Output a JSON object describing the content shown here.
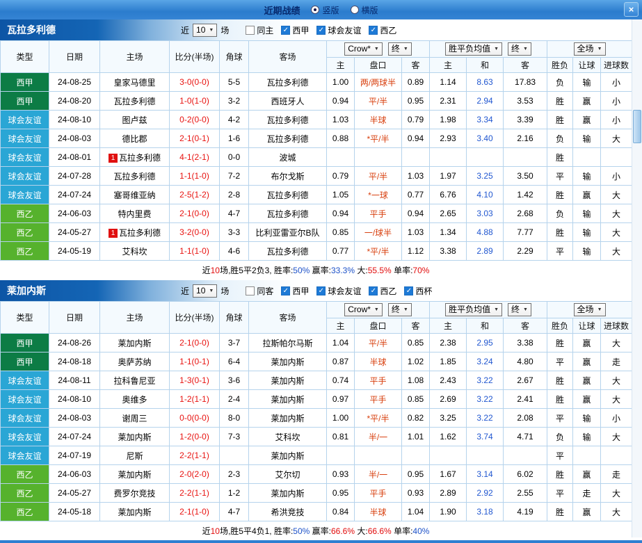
{
  "titlebar": {
    "title": "近期战绩",
    "radios": [
      {
        "label": "竖版",
        "selected": true
      },
      {
        "label": "横版",
        "selected": false
      }
    ],
    "close_label": "×"
  },
  "table_header": {
    "left": [
      "类型",
      "日期",
      "主场",
      "比分(半场)",
      "角球",
      "客场"
    ],
    "sub": [
      "主",
      "盘口",
      "客",
      "主",
      "和",
      "客",
      "胜负",
      "让球",
      "进球数"
    ]
  },
  "type_colors": {
    "西甲": "#0c7c45",
    "球会友谊": "#2aa6d5",
    "西乙": "#56b22d"
  },
  "colors": {
    "result_red": "#e10b0b",
    "result_blue": "#1c51c8",
    "result_green": "#0fa00f",
    "score_red": "#e8120f",
    "handicap_red": "#d8400f",
    "avg_mid_blue": "#2157d0",
    "tracked_team_green": "#13a113"
  },
  "sections": [
    {
      "team": "瓦拉多利德",
      "near_label": "近",
      "games": "10",
      "games_suffix": "场",
      "filters": [
        {
          "label": "同主",
          "checked": false
        },
        {
          "label": "西甲",
          "checked": true
        },
        {
          "label": "球会友谊",
          "checked": true
        },
        {
          "label": "西乙",
          "checked": true
        }
      ],
      "selects": {
        "bookmaker": "Crow*",
        "book_time": "终",
        "avg": "胜平负均值",
        "avg_time": "终",
        "scope": "全场"
      },
      "rows": [
        {
          "type": "西甲",
          "date": "24-08-25",
          "home": "皇家马德里",
          "home_t": false,
          "badge": false,
          "score": "3-0(0-0)",
          "corner": "5-5",
          "away": "瓦拉多利德",
          "away_t": true,
          "o_home": "1.00",
          "handicap": "两/两球半",
          "o_away": "0.89",
          "avg_home": "1.14",
          "avg_draw": "8.63",
          "avg_away": "17.83",
          "res": "负",
          "ah": "输",
          "ou": "小"
        },
        {
          "type": "西甲",
          "date": "24-08-20",
          "home": "瓦拉多利德",
          "home_t": true,
          "badge": false,
          "score": "1-0(1-0)",
          "corner": "3-2",
          "away": "西班牙人",
          "away_t": false,
          "o_home": "0.94",
          "handicap": "平/半",
          "o_away": "0.95",
          "avg_home": "2.31",
          "avg_draw": "2.94",
          "avg_away": "3.53",
          "res": "胜",
          "ah": "赢",
          "ou": "小"
        },
        {
          "type": "球会友谊",
          "date": "24-08-10",
          "home": "图卢兹",
          "home_t": false,
          "badge": false,
          "score": "0-2(0-0)",
          "corner": "4-2",
          "away": "瓦拉多利德",
          "away_t": true,
          "o_home": "1.03",
          "handicap": "半球",
          "o_away": "0.79",
          "avg_home": "1.98",
          "avg_draw": "3.34",
          "avg_away": "3.39",
          "res": "胜",
          "ah": "赢",
          "ou": "小"
        },
        {
          "type": "球会友谊",
          "date": "24-08-03",
          "home": "德比郡",
          "home_t": false,
          "badge": false,
          "score": "2-1(0-1)",
          "corner": "1-6",
          "away": "瓦拉多利德",
          "away_t": true,
          "o_home": "0.88",
          "handicap": "*平/半",
          "o_away": "0.94",
          "avg_home": "2.93",
          "avg_draw": "3.40",
          "avg_away": "2.16",
          "res": "负",
          "ah": "输",
          "ou": "大"
        },
        {
          "type": "球会友谊",
          "date": "24-08-01",
          "home": "瓦拉多利德",
          "home_t": true,
          "badge": true,
          "score": "4-1(2-1)",
          "corner": "0-0",
          "away": "波城",
          "away_t": false,
          "o_home": "",
          "handicap": "",
          "o_away": "",
          "avg_home": "",
          "avg_draw": "",
          "avg_away": "",
          "res": "胜",
          "ah": "",
          "ou": ""
        },
        {
          "type": "球会友谊",
          "date": "24-07-28",
          "home": "瓦拉多利德",
          "home_t": true,
          "badge": false,
          "score": "1-1(1-0)",
          "corner": "7-2",
          "away": "布尔戈斯",
          "away_t": false,
          "o_home": "0.79",
          "handicap": "平/半",
          "o_away": "1.03",
          "avg_home": "1.97",
          "avg_draw": "3.25",
          "avg_away": "3.50",
          "res": "平",
          "ah": "输",
          "ou": "小"
        },
        {
          "type": "球会友谊",
          "date": "24-07-24",
          "home": "塞哥维亚纳",
          "home_t": false,
          "badge": false,
          "score": "2-5(1-2)",
          "corner": "2-8",
          "away": "瓦拉多利德",
          "away_t": true,
          "o_home": "1.05",
          "handicap": "*一球",
          "o_away": "0.77",
          "avg_home": "6.76",
          "avg_draw": "4.10",
          "avg_away": "1.42",
          "res": "胜",
          "ah": "赢",
          "ou": "大"
        },
        {
          "type": "西乙",
          "date": "24-06-03",
          "home": "特内里费",
          "home_t": false,
          "badge": false,
          "score": "2-1(0-0)",
          "corner": "4-7",
          "away": "瓦拉多利德",
          "away_t": true,
          "o_home": "0.94",
          "handicap": "平手",
          "o_away": "0.94",
          "avg_home": "2.65",
          "avg_draw": "3.03",
          "avg_away": "2.68",
          "res": "负",
          "ah": "输",
          "ou": "大"
        },
        {
          "type": "西乙",
          "date": "24-05-27",
          "home": "瓦拉多利德",
          "home_t": true,
          "badge": true,
          "score": "3-2(0-0)",
          "corner": "3-3",
          "away": "比利亚雷亚尔B队",
          "away_t": false,
          "o_home": "0.85",
          "handicap": "一/球半",
          "o_away": "1.03",
          "avg_home": "1.34",
          "avg_draw": "4.88",
          "avg_away": "7.77",
          "res": "胜",
          "ah": "输",
          "ou": "大"
        },
        {
          "type": "西乙",
          "date": "24-05-19",
          "home": "艾科坎",
          "home_t": false,
          "badge": false,
          "score": "1-1(1-0)",
          "corner": "4-6",
          "away": "瓦拉多利德",
          "away_t": true,
          "o_home": "0.77",
          "handicap": "*平/半",
          "o_away": "1.12",
          "avg_home": "3.38",
          "avg_draw": "2.89",
          "avg_away": "2.29",
          "res": "平",
          "ah": "输",
          "ou": "大"
        }
      ],
      "summary": [
        {
          "t": "近",
          "c": "k"
        },
        {
          "t": "10",
          "c": "r"
        },
        {
          "t": "场,胜5平2负3, 胜率:",
          "c": "k"
        },
        {
          "t": "50%",
          "c": "b"
        },
        {
          "t": " 赢率:",
          "c": "k"
        },
        {
          "t": "33.3%",
          "c": "b"
        },
        {
          "t": " 大:",
          "c": "k"
        },
        {
          "t": "55.5%",
          "c": "r"
        },
        {
          "t": " 单率:",
          "c": "k"
        },
        {
          "t": "70%",
          "c": "r"
        }
      ]
    },
    {
      "team": "莱加内斯",
      "near_label": "近",
      "games": "10",
      "games_suffix": "场",
      "filters": [
        {
          "label": "同客",
          "checked": false
        },
        {
          "label": "西甲",
          "checked": true
        },
        {
          "label": "球会友谊",
          "checked": true
        },
        {
          "label": "西乙",
          "checked": true
        },
        {
          "label": "西杯",
          "checked": true
        }
      ],
      "selects": {
        "bookmaker": "Crow*",
        "book_time": "终",
        "avg": "胜平负均值",
        "avg_time": "终",
        "scope": "全场"
      },
      "rows": [
        {
          "type": "西甲",
          "date": "24-08-26",
          "home": "莱加内斯",
          "home_t": true,
          "badge": false,
          "score": "2-1(0-0)",
          "corner": "3-7",
          "away": "拉斯帕尔马斯",
          "away_t": false,
          "o_home": "1.04",
          "handicap": "平/半",
          "o_away": "0.85",
          "avg_home": "2.38",
          "avg_draw": "2.95",
          "avg_away": "3.38",
          "res": "胜",
          "ah": "赢",
          "ou": "大"
        },
        {
          "type": "西甲",
          "date": "24-08-18",
          "home": "奥萨苏纳",
          "home_t": false,
          "badge": false,
          "score": "1-1(0-1)",
          "corner": "6-4",
          "away": "莱加内斯",
          "away_t": true,
          "o_home": "0.87",
          "handicap": "半球",
          "o_away": "1.02",
          "avg_home": "1.85",
          "avg_draw": "3.24",
          "avg_away": "4.80",
          "res": "平",
          "ah": "赢",
          "ou": "走"
        },
        {
          "type": "球会友谊",
          "date": "24-08-11",
          "home": "拉科鲁尼亚",
          "home_t": false,
          "badge": false,
          "score": "1-3(0-1)",
          "corner": "3-6",
          "away": "莱加内斯",
          "away_t": true,
          "o_home": "0.74",
          "handicap": "平手",
          "o_away": "1.08",
          "avg_home": "2.43",
          "avg_draw": "3.22",
          "avg_away": "2.67",
          "res": "胜",
          "ah": "赢",
          "ou": "大"
        },
        {
          "type": "球会友谊",
          "date": "24-08-10",
          "home": "奥维多",
          "home_t": false,
          "badge": false,
          "score": "1-2(1-1)",
          "corner": "2-4",
          "away": "莱加内斯",
          "away_t": true,
          "o_home": "0.97",
          "handicap": "平手",
          "o_away": "0.85",
          "avg_home": "2.69",
          "avg_draw": "3.22",
          "avg_away": "2.41",
          "res": "胜",
          "ah": "赢",
          "ou": "大"
        },
        {
          "type": "球会友谊",
          "date": "24-08-03",
          "home": "谢周三",
          "home_t": false,
          "badge": false,
          "score": "0-0(0-0)",
          "corner": "8-0",
          "away": "莱加内斯",
          "away_t": true,
          "o_home": "1.00",
          "handicap": "*平/半",
          "o_away": "0.82",
          "avg_home": "3.25",
          "avg_draw": "3.22",
          "avg_away": "2.08",
          "res": "平",
          "ah": "输",
          "ou": "小"
        },
        {
          "type": "球会友谊",
          "date": "24-07-24",
          "home": "莱加内斯",
          "home_t": true,
          "badge": false,
          "score": "1-2(0-0)",
          "corner": "7-3",
          "away": "艾科坎",
          "away_t": false,
          "o_home": "0.81",
          "handicap": "半/一",
          "o_away": "1.01",
          "avg_home": "1.62",
          "avg_draw": "3.74",
          "avg_away": "4.71",
          "res": "负",
          "ah": "输",
          "ou": "大"
        },
        {
          "type": "球会友谊",
          "date": "24-07-19",
          "home": "尼斯",
          "home_t": false,
          "badge": false,
          "score": "2-2(1-1)",
          "corner": "",
          "away": "莱加内斯",
          "away_t": true,
          "o_home": "",
          "handicap": "",
          "o_away": "",
          "avg_home": "",
          "avg_draw": "",
          "avg_away": "",
          "res": "平",
          "ah": "",
          "ou": ""
        },
        {
          "type": "西乙",
          "date": "24-06-03",
          "home": "莱加内斯",
          "home_t": true,
          "badge": false,
          "score": "2-0(2-0)",
          "corner": "2-3",
          "away": "艾尔切",
          "away_t": false,
          "o_home": "0.93",
          "handicap": "半/一",
          "o_away": "0.95",
          "avg_home": "1.67",
          "avg_draw": "3.14",
          "avg_away": "6.02",
          "res": "胜",
          "ah": "赢",
          "ou": "走"
        },
        {
          "type": "西乙",
          "date": "24-05-27",
          "home": "费罗尔竞技",
          "home_t": false,
          "badge": false,
          "score": "2-2(1-1)",
          "corner": "1-2",
          "away": "莱加内斯",
          "away_t": true,
          "o_home": "0.95",
          "handicap": "平手",
          "o_away": "0.93",
          "avg_home": "2.89",
          "avg_draw": "2.92",
          "avg_away": "2.55",
          "res": "平",
          "ah": "走",
          "ou": "大"
        },
        {
          "type": "西乙",
          "date": "24-05-18",
          "home": "莱加内斯",
          "home_t": true,
          "badge": false,
          "score": "2-1(1-0)",
          "corner": "4-7",
          "away": "希洪竞技",
          "away_t": false,
          "o_home": "0.84",
          "handicap": "半球",
          "o_away": "1.04",
          "avg_home": "1.90",
          "avg_draw": "3.18",
          "avg_away": "4.19",
          "res": "胜",
          "ah": "赢",
          "ou": "大"
        }
      ],
      "summary": [
        {
          "t": "近",
          "c": "k"
        },
        {
          "t": "10",
          "c": "r"
        },
        {
          "t": "场,胜5平4负1, 胜率:",
          "c": "k"
        },
        {
          "t": "50%",
          "c": "b"
        },
        {
          "t": " 赢率:",
          "c": "k"
        },
        {
          "t": "66.6%",
          "c": "r"
        },
        {
          "t": " 大:",
          "c": "k"
        },
        {
          "t": "66.6%",
          "c": "r"
        },
        {
          "t": " 单率:",
          "c": "k"
        },
        {
          "t": "40%",
          "c": "b"
        }
      ]
    }
  ]
}
